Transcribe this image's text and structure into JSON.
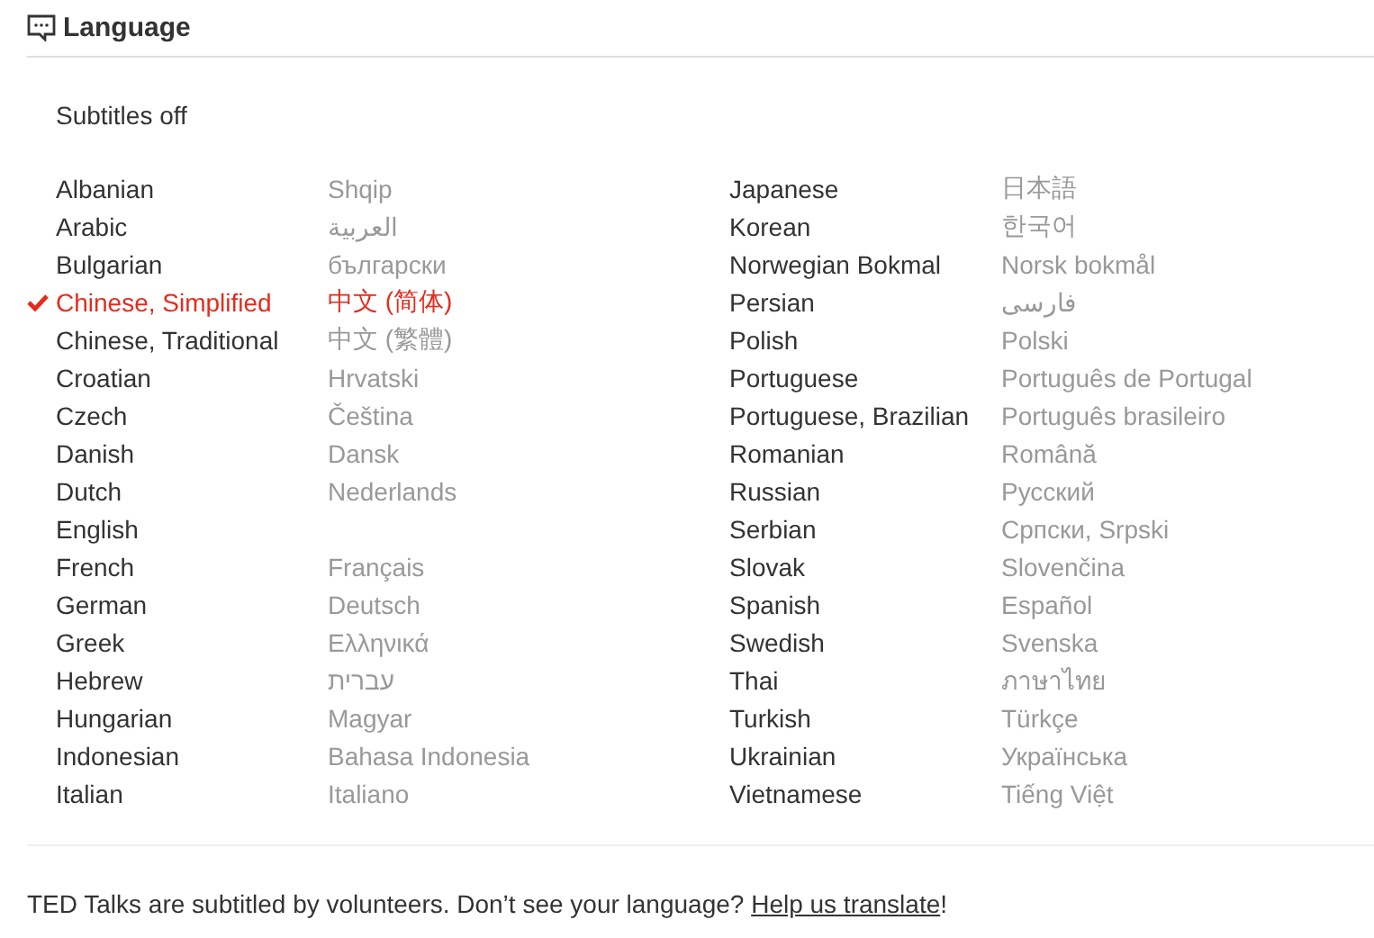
{
  "header": {
    "title": "Language"
  },
  "subtitles_off": {
    "label": "Subtitles off",
    "selected": false
  },
  "columns": [
    {
      "items": [
        {
          "name": "Albanian",
          "native": "Shqip",
          "selected": false
        },
        {
          "name": "Arabic",
          "native": "العربية",
          "selected": false
        },
        {
          "name": "Bulgarian",
          "native": "български",
          "selected": false
        },
        {
          "name": "Chinese, Simplified",
          "native": "中文 (简体)",
          "selected": true
        },
        {
          "name": "Chinese, Traditional",
          "native": "中文 (繁體)",
          "selected": false
        },
        {
          "name": "Croatian",
          "native": "Hrvatski",
          "selected": false
        },
        {
          "name": "Czech",
          "native": "Čeština",
          "selected": false
        },
        {
          "name": "Danish",
          "native": "Dansk",
          "selected": false
        },
        {
          "name": "Dutch",
          "native": "Nederlands",
          "selected": false
        },
        {
          "name": "English",
          "selected": false
        },
        {
          "name": "French",
          "native": "Français",
          "selected": false
        },
        {
          "name": "German",
          "native": "Deutsch",
          "selected": false
        },
        {
          "name": "Greek",
          "native": "Ελληνικά",
          "selected": false
        },
        {
          "name": "Hebrew",
          "native": "עברית",
          "selected": false
        },
        {
          "name": "Hungarian",
          "native": "Magyar",
          "selected": false
        },
        {
          "name": "Indonesian",
          "native": "Bahasa Indonesia",
          "selected": false
        },
        {
          "name": "Italian",
          "native": "Italiano",
          "selected": false
        }
      ]
    },
    {
      "items": [
        {
          "name": "Japanese",
          "native": "日本語",
          "selected": false
        },
        {
          "name": "Korean",
          "native": "한국어",
          "selected": false
        },
        {
          "name": "Norwegian Bokmal",
          "native": "Norsk bokmål",
          "selected": false
        },
        {
          "name": "Persian",
          "native": "فارسی",
          "selected": false
        },
        {
          "name": "Polish",
          "native": "Polski",
          "selected": false
        },
        {
          "name": "Portuguese",
          "native": "Português de Portugal",
          "selected": false
        },
        {
          "name": "Portuguese, Brazilian",
          "native": "Português brasileiro",
          "selected": false
        },
        {
          "name": "Romanian",
          "native": "Română",
          "selected": false
        },
        {
          "name": "Russian",
          "native": "Русский",
          "selected": false
        },
        {
          "name": "Serbian",
          "native": "Српски, Srpski",
          "selected": false
        },
        {
          "name": "Slovak",
          "native": "Slovenčina",
          "selected": false
        },
        {
          "name": "Spanish",
          "native": "Español",
          "selected": false
        },
        {
          "name": "Swedish",
          "native": "Svenska",
          "selected": false
        },
        {
          "name": "Thai",
          "native": "ภาษาไทย",
          "selected": false
        },
        {
          "name": "Turkish",
          "native": "Türkçe",
          "selected": false
        },
        {
          "name": "Ukrainian",
          "native": "Українська",
          "selected": false
        },
        {
          "name": "Vietnamese",
          "native": "Tiếng Việt",
          "selected": false
        }
      ]
    }
  ],
  "footer": {
    "text": "TED Talks are subtitled by volunteers. Don’t see your language? ",
    "link": "Help us translate",
    "after": "!"
  }
}
